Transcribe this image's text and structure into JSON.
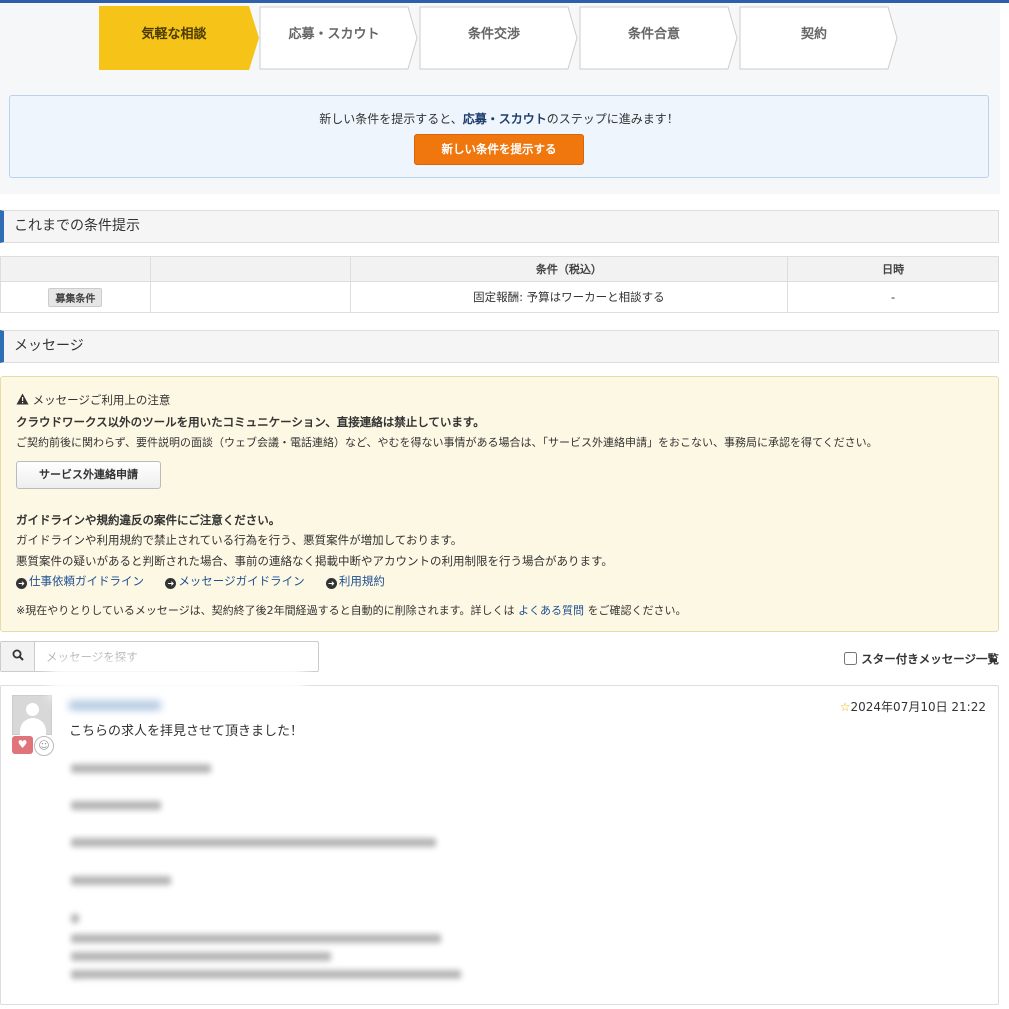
{
  "steps": [
    {
      "label": "気軽な相談",
      "active": true
    },
    {
      "label": "応募・スカウト",
      "active": false
    },
    {
      "label": "条件交渉",
      "active": false
    },
    {
      "label": "条件合意",
      "active": false
    },
    {
      "label": "契約",
      "active": false
    }
  ],
  "notice": {
    "text_before": "新しい条件を提示すると、",
    "text_bold": "応募・スカウト",
    "text_after": "のステップに進みます！",
    "button_label": "新しい条件を提示する"
  },
  "conditions_section": {
    "title": "これまでの条件提示",
    "headers": [
      "",
      "",
      "条件（税込）",
      "日時"
    ],
    "rows": [
      {
        "tag": "募集条件",
        "blank": "",
        "condition": "固定報酬: 予算はワーカーと相談する",
        "datetime": "-"
      }
    ]
  },
  "messages_section": {
    "title": "メッセージ"
  },
  "warning": {
    "heading_icon": "warning-triangle-icon",
    "heading": "メッセージご利用上の注意",
    "line1": "クラウドワークス以外のツールを用いたコミュニケーション、直接連絡は禁止しています。",
    "line2": "ご契約前後に関わらず、要件説明の面談（ウェブ会議・電話連絡）など、やむを得ない事情がある場合は、「サービス外連絡申請」をおこない、事務局に承認を得てください。",
    "button_label": "サービス外連絡申請",
    "guideline_heading": "ガイドラインや規約違反の案件にご注意ください。",
    "guideline_line1": "ガイドラインや利用規約で禁止されている行為を行う、悪質案件が増加しております。",
    "guideline_line2": "悪質案件の疑いがあると判断された場合、事前の連絡なく掲載中断やアカウントの利用制限を行う場合があります。",
    "links": [
      "仕事依頼ガイドライン",
      "メッセージガイドライン",
      "利用規約"
    ],
    "footer_before": "※現在やりとりしているメッセージは、契約終了後2年間経過すると自動的に削除されます。詳しくは",
    "footer_link": "よくある質問",
    "footer_after": "をご確認ください。"
  },
  "search": {
    "placeholder": "メッセージを探す",
    "icon": "search-icon"
  },
  "star_filter_label": "スター付きメッセージ一覧",
  "message": {
    "text": "こちらの求人を拝見させて頂きました！",
    "datetime": "2024年07月10日 21:22",
    "star_icon": "star-outline-icon",
    "reactions": [
      "heart-icon",
      "emoji-icon"
    ]
  },
  "colors": {
    "accent": "#2f6db5",
    "active_step": "#f5c518",
    "primary_button": "#f0760e"
  }
}
